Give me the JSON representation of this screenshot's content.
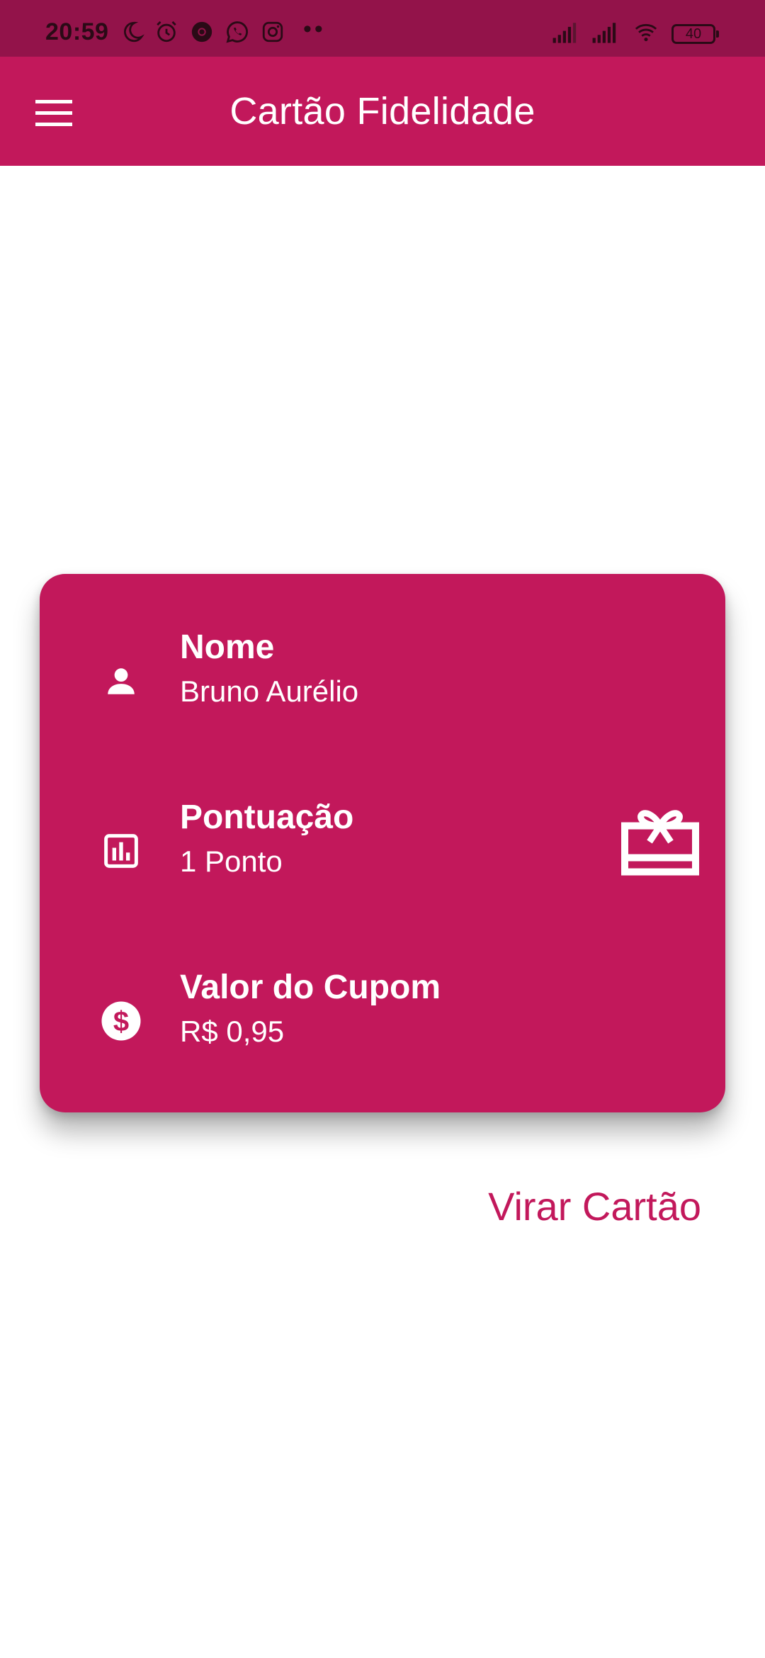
{
  "status_bar": {
    "time": "20:59",
    "battery": "40",
    "icons": [
      "moon-icon",
      "alarm-icon",
      "chrome-icon",
      "whatsapp-icon",
      "instagram-icon",
      "more-dots-icon",
      "signal-icon",
      "signal-icon",
      "wifi-icon",
      "battery-icon"
    ],
    "overflow": "••"
  },
  "app_bar": {
    "title": "Cartão Fidelidade",
    "menu_icon": "menu-icon"
  },
  "card": {
    "rows": [
      {
        "label": "Nome",
        "value": "Bruno Aurélio",
        "icon": "person-icon"
      },
      {
        "label": "Pontuação",
        "value": "1 Ponto",
        "icon": "chart-icon"
      },
      {
        "label": "Valor do Cupom",
        "value": "R$ 0,95",
        "icon": "dollar-icon"
      }
    ],
    "badge_icon": "gift-card-icon"
  },
  "actions": {
    "flip_label": "Virar Cartão"
  },
  "colors": {
    "primary": "#c2185b",
    "status_bar": "#93134a",
    "on_primary": "#ffffff"
  }
}
